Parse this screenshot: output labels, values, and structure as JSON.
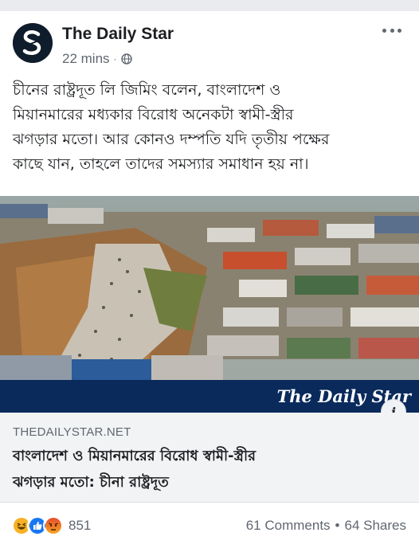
{
  "post": {
    "page_name": "The Daily Star",
    "time": "22 mins",
    "separator": "·",
    "text_lines": [
      "চীনের রাষ্ট্রদূত লি জিমিং বলেন, বাংলাদেশ ও",
      "মিয়ানমারের মধ্যকার বিরোধ অনেকটা স্বামী-স্ত্রীর",
      "ঝগড়ার মতো। আর কোনও দম্পতি যদি তৃতীয় পক্ষের",
      "কাছে যান, তাহলে তাদের সমস্যার সমাধান হয় না।"
    ]
  },
  "image": {
    "logo_text": "The Daily Star"
  },
  "link": {
    "domain": "THEDAILYSTAR.NET",
    "title_lines": [
      "বাংলাদেশ ও মিয়ানমারের বিরোধ স্বামী-স্ত্রীর",
      "ঝগড়ার মতো: চীনা রাষ্ট্রদূত"
    ]
  },
  "engagement": {
    "reaction_icons": [
      "haha-icon",
      "like-icon",
      "angry-icon"
    ],
    "reaction_count": "851",
    "comments": "61 Comments",
    "separator": "•",
    "shares": "64 Shares"
  },
  "colors": {
    "banner": "#0a2a5c",
    "like": "#1877f2",
    "haha": "#f7b125",
    "angry": "#e9710f"
  }
}
